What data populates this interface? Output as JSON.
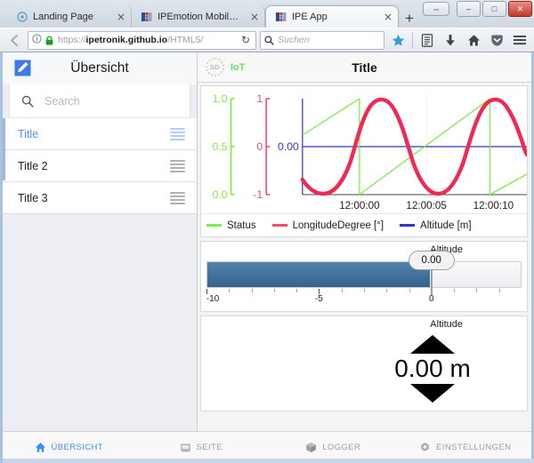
{
  "browser": {
    "tabs": [
      {
        "title": "Landing Page",
        "favicon": "circle-icon",
        "active": false
      },
      {
        "title": "IPEmotion Mobile Edition -...",
        "favicon": "ipe-icon",
        "active": false
      },
      {
        "title": "IPE App",
        "favicon": "ipe-icon",
        "active": true
      }
    ],
    "new_tab_label": "+",
    "close_label": "×",
    "window_controls": {
      "restore_down": "⇔",
      "minimize": "–",
      "maximize": "□",
      "close": "✕"
    },
    "back_label": "←",
    "identity_icon": "info-icon",
    "lock_icon": "padlock-icon",
    "url_prefix": "https://",
    "url_domain": "ipetronik.github.io",
    "url_path": "/HTML5/",
    "reload_label": "↻",
    "search_placeholder": "Suchen",
    "search_icon": "search-icon",
    "toolbar_icons": [
      "bookmark-star-icon",
      "library-icon",
      "downloads-icon",
      "home-icon",
      "pocket-icon",
      "menu-hamburger-icon"
    ]
  },
  "sidebar": {
    "edit_icon": "edit-pencil-icon",
    "title": "Übersicht",
    "search": {
      "icon": "search-icon",
      "value": "",
      "placeholder": "Search"
    },
    "items": [
      {
        "label": "Title",
        "selected": true,
        "handle_icon": "drag-handle-icon"
      },
      {
        "label": "Title 2",
        "selected": false,
        "handle_icon": "drag-handle-icon"
      },
      {
        "label": "Title 3",
        "selected": false,
        "handle_icon": "drag-handle-icon"
      }
    ]
  },
  "app_header": {
    "badge_text": "SD",
    "badge_icon": "sd-card-status-icon",
    "connection_label": "IoT",
    "connection_color": "#6ddc6d",
    "title": "Title"
  },
  "chart_data": {
    "type": "line",
    "title": "",
    "xlabel": "",
    "ylabel": "",
    "grid": false,
    "legend_position": "bottom",
    "x_tick_labels": [
      "12:00:00",
      "12:00:05",
      "12:00:10"
    ],
    "axes": [
      {
        "name": "Status",
        "color": "#7ded4a",
        "ticks": [
          "1.0",
          "0.5",
          "0.0"
        ],
        "range": [
          0,
          1
        ]
      },
      {
        "name": "LongitudeDegree",
        "color": "#ef4b6a",
        "ticks": [
          "1",
          "0",
          "-1"
        ],
        "range": [
          -1,
          1
        ]
      },
      {
        "name": "Altitude",
        "color": "#3333cc",
        "ticks": [
          "0.00"
        ],
        "range": [
          -1,
          1
        ]
      }
    ],
    "series": [
      {
        "name": "Status",
        "label": "Status",
        "color": "#7ded4a",
        "waveform": "sawtooth",
        "period_s": 7.0,
        "min": 0,
        "max": 1
      },
      {
        "name": "LongitudeDegree",
        "label": "LongitudeDegree [°]",
        "color": "#ef2a55",
        "waveform": "sine",
        "period_s": 7.0,
        "amplitude": 1,
        "min": -1,
        "max": 1
      },
      {
        "name": "Altitude",
        "label": "Altitude [m]",
        "color": "#3333cc",
        "waveform": "constant",
        "value": 0.0
      }
    ]
  },
  "slider_widget": {
    "title": "Altitude",
    "value": "0.00",
    "value_number": 0,
    "min": -10,
    "max": 4,
    "tick_labels": [
      {
        "text": "-10",
        "value": -10
      },
      {
        "text": "-5",
        "value": -5
      },
      {
        "text": "0",
        "value": 0
      }
    ]
  },
  "gauge_widget": {
    "title": "Altitude",
    "value": "0.00 m",
    "up_icon": "triangle-up-icon",
    "down_icon": "triangle-down-icon"
  },
  "bottom_nav": [
    {
      "label": "ÜBERSICHT",
      "icon": "home-icon",
      "active": true
    },
    {
      "label": "SEITE",
      "icon": "page-icon",
      "active": false
    },
    {
      "label": "LOGGER",
      "icon": "cube-icon",
      "active": false
    },
    {
      "label": "EINSTELLUNGEN",
      "icon": "gear-icon",
      "active": false
    }
  ]
}
